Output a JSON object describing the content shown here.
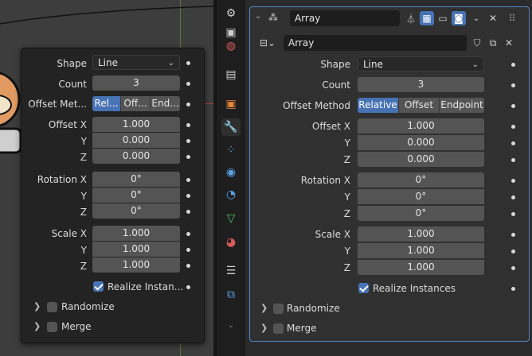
{
  "popup": {
    "shape_label": "Shape",
    "shape_value": "Line",
    "count_label": "Count",
    "count_value": "3",
    "offset_method_label": "Offset Met...",
    "offset_method_options": [
      "Rel...",
      "Off...",
      "End..."
    ],
    "offset_x_label": "Offset X",
    "offset_y_label": "Y",
    "offset_z_label": "Z",
    "offset_values": [
      "1.000",
      "0.000",
      "0.000"
    ],
    "rotation_x_label": "Rotation X",
    "rotation_y_label": "Y",
    "rotation_z_label": "Z",
    "rotation_values": [
      "0°",
      "0°",
      "0°"
    ],
    "scale_x_label": "Scale X",
    "scale_y_label": "Y",
    "scale_z_label": "Z",
    "scale_values": [
      "1.000",
      "1.000",
      "1.000"
    ],
    "realize_label": "Realize Instan...",
    "randomize_label": "Randomize",
    "merge_label": "Merge"
  },
  "modifier": {
    "header_name": "Array",
    "node_group_name": "Array",
    "shape_label": "Shape",
    "shape_value": "Line",
    "count_label": "Count",
    "count_value": "3",
    "offset_method_label": "Offset Method",
    "offset_method_options": [
      "Relative",
      "Offset",
      "Endpoint"
    ],
    "offset_x_label": "Offset X",
    "offset_y_label": "Y",
    "offset_z_label": "Z",
    "offset_values": [
      "1.000",
      "0.000",
      "0.000"
    ],
    "rotation_x_label": "Rotation X",
    "rotation_y_label": "Y",
    "rotation_z_label": "Z",
    "rotation_values": [
      "0°",
      "0°",
      "0°"
    ],
    "scale_x_label": "Scale X",
    "scale_y_label": "Y",
    "scale_z_label": "Z",
    "scale_values": [
      "1.000",
      "1.000",
      "1.000"
    ],
    "realize_label": "Realize Instances",
    "randomize_label": "Randomize",
    "merge_label": "Merge"
  },
  "colors": {
    "accent": "#4772b3",
    "field": "#545454",
    "panel_border": "#4f86c6"
  },
  "tab_icons": [
    "tool-icon",
    "render-icon",
    "output-icon",
    "view-layer-icon",
    "object-icon",
    "modifier-wrench-icon",
    "particles-icon",
    "physics-icon",
    "constraints-icon",
    "data-icon",
    "material-icon",
    "texture-icon",
    "world-icon"
  ]
}
